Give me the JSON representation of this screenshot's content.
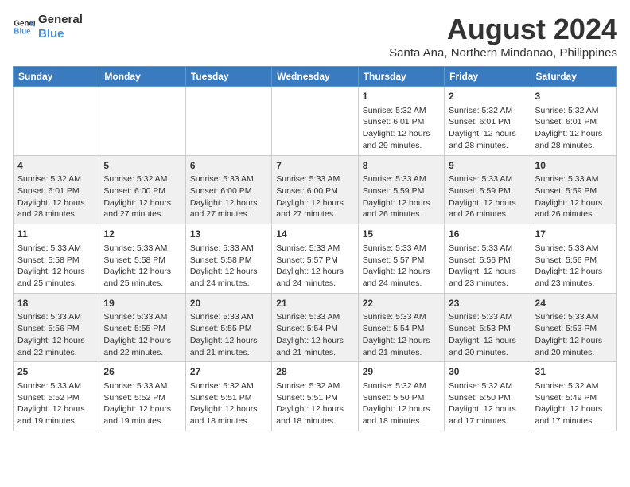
{
  "header": {
    "logo_line1": "General",
    "logo_line2": "Blue",
    "month": "August 2024",
    "location": "Santa Ana, Northern Mindanao, Philippines"
  },
  "days_of_week": [
    "Sunday",
    "Monday",
    "Tuesday",
    "Wednesday",
    "Thursday",
    "Friday",
    "Saturday"
  ],
  "weeks": [
    [
      {
        "day": "",
        "info": ""
      },
      {
        "day": "",
        "info": ""
      },
      {
        "day": "",
        "info": ""
      },
      {
        "day": "",
        "info": ""
      },
      {
        "day": "1",
        "info": "Sunrise: 5:32 AM\nSunset: 6:01 PM\nDaylight: 12 hours\nand 29 minutes."
      },
      {
        "day": "2",
        "info": "Sunrise: 5:32 AM\nSunset: 6:01 PM\nDaylight: 12 hours\nand 28 minutes."
      },
      {
        "day": "3",
        "info": "Sunrise: 5:32 AM\nSunset: 6:01 PM\nDaylight: 12 hours\nand 28 minutes."
      }
    ],
    [
      {
        "day": "4",
        "info": "Sunrise: 5:32 AM\nSunset: 6:01 PM\nDaylight: 12 hours\nand 28 minutes."
      },
      {
        "day": "5",
        "info": "Sunrise: 5:32 AM\nSunset: 6:00 PM\nDaylight: 12 hours\nand 27 minutes."
      },
      {
        "day": "6",
        "info": "Sunrise: 5:33 AM\nSunset: 6:00 PM\nDaylight: 12 hours\nand 27 minutes."
      },
      {
        "day": "7",
        "info": "Sunrise: 5:33 AM\nSunset: 6:00 PM\nDaylight: 12 hours\nand 27 minutes."
      },
      {
        "day": "8",
        "info": "Sunrise: 5:33 AM\nSunset: 5:59 PM\nDaylight: 12 hours\nand 26 minutes."
      },
      {
        "day": "9",
        "info": "Sunrise: 5:33 AM\nSunset: 5:59 PM\nDaylight: 12 hours\nand 26 minutes."
      },
      {
        "day": "10",
        "info": "Sunrise: 5:33 AM\nSunset: 5:59 PM\nDaylight: 12 hours\nand 26 minutes."
      }
    ],
    [
      {
        "day": "11",
        "info": "Sunrise: 5:33 AM\nSunset: 5:58 PM\nDaylight: 12 hours\nand 25 minutes."
      },
      {
        "day": "12",
        "info": "Sunrise: 5:33 AM\nSunset: 5:58 PM\nDaylight: 12 hours\nand 25 minutes."
      },
      {
        "day": "13",
        "info": "Sunrise: 5:33 AM\nSunset: 5:58 PM\nDaylight: 12 hours\nand 24 minutes."
      },
      {
        "day": "14",
        "info": "Sunrise: 5:33 AM\nSunset: 5:57 PM\nDaylight: 12 hours\nand 24 minutes."
      },
      {
        "day": "15",
        "info": "Sunrise: 5:33 AM\nSunset: 5:57 PM\nDaylight: 12 hours\nand 24 minutes."
      },
      {
        "day": "16",
        "info": "Sunrise: 5:33 AM\nSunset: 5:56 PM\nDaylight: 12 hours\nand 23 minutes."
      },
      {
        "day": "17",
        "info": "Sunrise: 5:33 AM\nSunset: 5:56 PM\nDaylight: 12 hours\nand 23 minutes."
      }
    ],
    [
      {
        "day": "18",
        "info": "Sunrise: 5:33 AM\nSunset: 5:56 PM\nDaylight: 12 hours\nand 22 minutes."
      },
      {
        "day": "19",
        "info": "Sunrise: 5:33 AM\nSunset: 5:55 PM\nDaylight: 12 hours\nand 22 minutes."
      },
      {
        "day": "20",
        "info": "Sunrise: 5:33 AM\nSunset: 5:55 PM\nDaylight: 12 hours\nand 21 minutes."
      },
      {
        "day": "21",
        "info": "Sunrise: 5:33 AM\nSunset: 5:54 PM\nDaylight: 12 hours\nand 21 minutes."
      },
      {
        "day": "22",
        "info": "Sunrise: 5:33 AM\nSunset: 5:54 PM\nDaylight: 12 hours\nand 21 minutes."
      },
      {
        "day": "23",
        "info": "Sunrise: 5:33 AM\nSunset: 5:53 PM\nDaylight: 12 hours\nand 20 minutes."
      },
      {
        "day": "24",
        "info": "Sunrise: 5:33 AM\nSunset: 5:53 PM\nDaylight: 12 hours\nand 20 minutes."
      }
    ],
    [
      {
        "day": "25",
        "info": "Sunrise: 5:33 AM\nSunset: 5:52 PM\nDaylight: 12 hours\nand 19 minutes."
      },
      {
        "day": "26",
        "info": "Sunrise: 5:33 AM\nSunset: 5:52 PM\nDaylight: 12 hours\nand 19 minutes."
      },
      {
        "day": "27",
        "info": "Sunrise: 5:32 AM\nSunset: 5:51 PM\nDaylight: 12 hours\nand 18 minutes."
      },
      {
        "day": "28",
        "info": "Sunrise: 5:32 AM\nSunset: 5:51 PM\nDaylight: 12 hours\nand 18 minutes."
      },
      {
        "day": "29",
        "info": "Sunrise: 5:32 AM\nSunset: 5:50 PM\nDaylight: 12 hours\nand 18 minutes."
      },
      {
        "day": "30",
        "info": "Sunrise: 5:32 AM\nSunset: 5:50 PM\nDaylight: 12 hours\nand 17 minutes."
      },
      {
        "day": "31",
        "info": "Sunrise: 5:32 AM\nSunset: 5:49 PM\nDaylight: 12 hours\nand 17 minutes."
      }
    ]
  ]
}
